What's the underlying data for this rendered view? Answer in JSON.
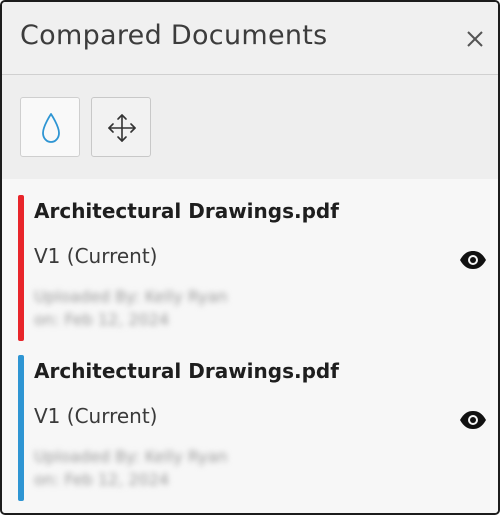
{
  "header": {
    "title": "Compared Documents",
    "close_icon": "close-icon"
  },
  "toolbar": {
    "tools": [
      {
        "name": "color-overlay",
        "icon": "droplet-icon",
        "active": true
      },
      {
        "name": "move-align",
        "icon": "move-icon",
        "active": false
      }
    ]
  },
  "documents": [
    {
      "name": "Architectural Drawings.pdf",
      "version": "V1 (Current)",
      "uploaded_by": "Uploaded By: Kelly Ryan",
      "uploaded_on": "on: Feb 12, 2024",
      "color": "#e8252a",
      "icon": "eye-icon"
    },
    {
      "name": "Architectural Drawings.pdf",
      "version": "V1 (Current)",
      "uploaded_by": "Uploaded By: Kelly Ryan",
      "uploaded_on": "on: Feb 12, 2024",
      "color": "#2e95d3",
      "icon": "eye-icon"
    }
  ],
  "colors": {
    "accent": "#2e95d3",
    "doc_a": "#e8252a",
    "doc_b": "#2e95d3"
  }
}
